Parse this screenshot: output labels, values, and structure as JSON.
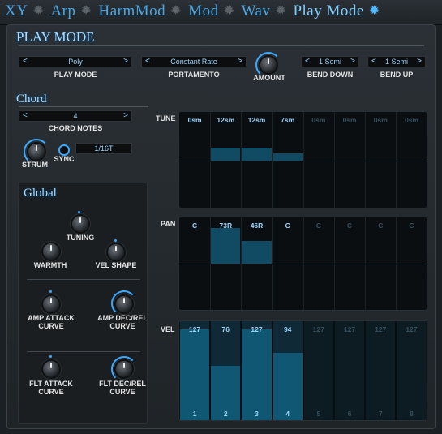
{
  "tabs": [
    {
      "label": "XY",
      "active": false
    },
    {
      "label": "Arp",
      "active": false
    },
    {
      "label": "HarmMod",
      "active": false
    },
    {
      "label": "Mod",
      "active": false
    },
    {
      "label": "Wav",
      "active": false
    },
    {
      "label": "Play Mode",
      "active": true
    }
  ],
  "play_mode": {
    "title": "PLAY MODE",
    "play_mode_value": "Poly",
    "play_mode_label": "PLAY MODE",
    "portamento_value": "Constant Rate",
    "portamento_label": "PORTAMENTO",
    "amount_label": "AMOUNT",
    "bend_down_value": "1 Semi",
    "bend_down_label": "BEND DOWN",
    "bend_up_value": "1 Semi",
    "bend_up_label": "BEND UP"
  },
  "chord": {
    "title": "Chord",
    "notes_value": "4",
    "notes_label": "CHORD NOTES",
    "strum_label": "STRUM",
    "sync_label": "SYNC",
    "sync_value": "1/16T"
  },
  "global": {
    "title": "Global",
    "tuning": "TUNING",
    "warmth": "WARMTH",
    "vel_shape": "VEL SHAPE",
    "amp_attack": [
      "AMP ATTACK",
      "CURVE"
    ],
    "amp_decrel": [
      "AMP DEC/REL",
      "CURVE"
    ],
    "flt_attack": [
      "FLT ATTACK",
      "CURVE"
    ],
    "flt_decrel": [
      "FLT DEC/REL",
      "CURVE"
    ]
  },
  "tune": {
    "label": "TUNE",
    "values": [
      "0sm",
      "12sm",
      "12sm",
      "7sm",
      "0sm",
      "0sm",
      "0sm",
      "0sm"
    ],
    "amount_semitones": [
      0,
      12,
      12,
      7,
      0,
      0,
      0,
      0
    ],
    "active": [
      true,
      true,
      true,
      true,
      false,
      false,
      false,
      false
    ]
  },
  "pan": {
    "label": "PAN",
    "values": [
      "C",
      "73R",
      "46R",
      "C",
      "C",
      "C",
      "C",
      "C"
    ],
    "amount_right": [
      0,
      73,
      46,
      0,
      0,
      0,
      0,
      0
    ],
    "active": [
      true,
      true,
      true,
      true,
      false,
      false,
      false,
      false
    ]
  },
  "vel": {
    "label": "VEL",
    "values": [
      "127",
      "76",
      "127",
      "94",
      "127",
      "127",
      "127",
      "127"
    ],
    "levels": [
      127,
      76,
      127,
      94,
      127,
      127,
      127,
      127
    ],
    "max": 127,
    "steps": [
      "1",
      "2",
      "3",
      "4",
      "5",
      "6",
      "7",
      "8"
    ],
    "active": [
      true,
      true,
      true,
      true,
      false,
      false,
      false,
      false
    ]
  },
  "colors": {
    "accent": "#3aa9ff",
    "text_active": "#9fd7ff",
    "text_inactive": "#36505f"
  }
}
